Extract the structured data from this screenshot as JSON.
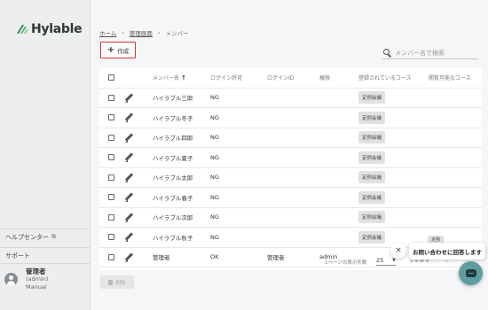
{
  "brand": {
    "name": "Hylable",
    "color": "#2e7d4f"
  },
  "sidebar": {
    "help": {
      "label": "ヘルプセンター",
      "icon": "external-link-icon"
    },
    "support": {
      "label": "サポート"
    },
    "user": {
      "name": "管理者",
      "id": "(admin)",
      "role": "Manual",
      "icon": "person-icon"
    }
  },
  "breadcrumb": {
    "home": "ホーム",
    "sep1": "›",
    "admin": "管理画面",
    "sep2": "›",
    "current": "メンバー"
  },
  "toolbar": {
    "create_label": "作成",
    "create_icon": "plus-icon",
    "create_highlight": "#e0332f"
  },
  "search": {
    "placeholder": "メンバー名で検索",
    "icon": "search-icon"
  },
  "table": {
    "columns": [
      "メンバー名",
      "ログイン許可",
      "ログインID",
      "権限",
      "登録されているコース",
      "閲覧可能なコース"
    ],
    "sort_indicator": "↑",
    "rows": [
      {
        "name": "ハイラブル三郎",
        "login": "NG",
        "login_id": "",
        "role": "",
        "course": "定例会議"
      },
      {
        "name": "ハイラブル冬子",
        "login": "NG",
        "login_id": "",
        "role": "",
        "course": "定例会議"
      },
      {
        "name": "ハイラブル四郎",
        "login": "NG",
        "login_id": "",
        "role": "",
        "course": "定例会議"
      },
      {
        "name": "ハイラブル夏子",
        "login": "NG",
        "login_id": "",
        "role": "",
        "course": "定例会議"
      },
      {
        "name": "ハイラブル太郎",
        "login": "NG",
        "login_id": "",
        "role": "",
        "course": "定例会議"
      },
      {
        "name": "ハイラブル春子",
        "login": "NG",
        "login_id": "",
        "role": "",
        "course": "定例会議"
      },
      {
        "name": "ハイラブル次郎",
        "login": "NG",
        "login_id": "",
        "role": "",
        "course": "定例会議"
      },
      {
        "name": "ハイラブル秋子",
        "login": "NG",
        "login_id": "",
        "role": "",
        "course": "定例会議"
      },
      {
        "name": "管理者",
        "login": "OK",
        "login_id": "管理者",
        "role": "admin",
        "course": ""
      }
    ],
    "partial_chip": "定例"
  },
  "pagination": {
    "rows_per_page_label": "1ページの表示件数",
    "rows_per_page": "25",
    "range": "1-9 of 9",
    "prev": "‹"
  },
  "actions": {
    "delete_label": "削除",
    "delete_icon": "trash-icon"
  },
  "chat": {
    "message": "お問い合わせに回答します",
    "close": "×",
    "fab_icon": "chat-icon",
    "fab_color": "#5f9ea0"
  }
}
